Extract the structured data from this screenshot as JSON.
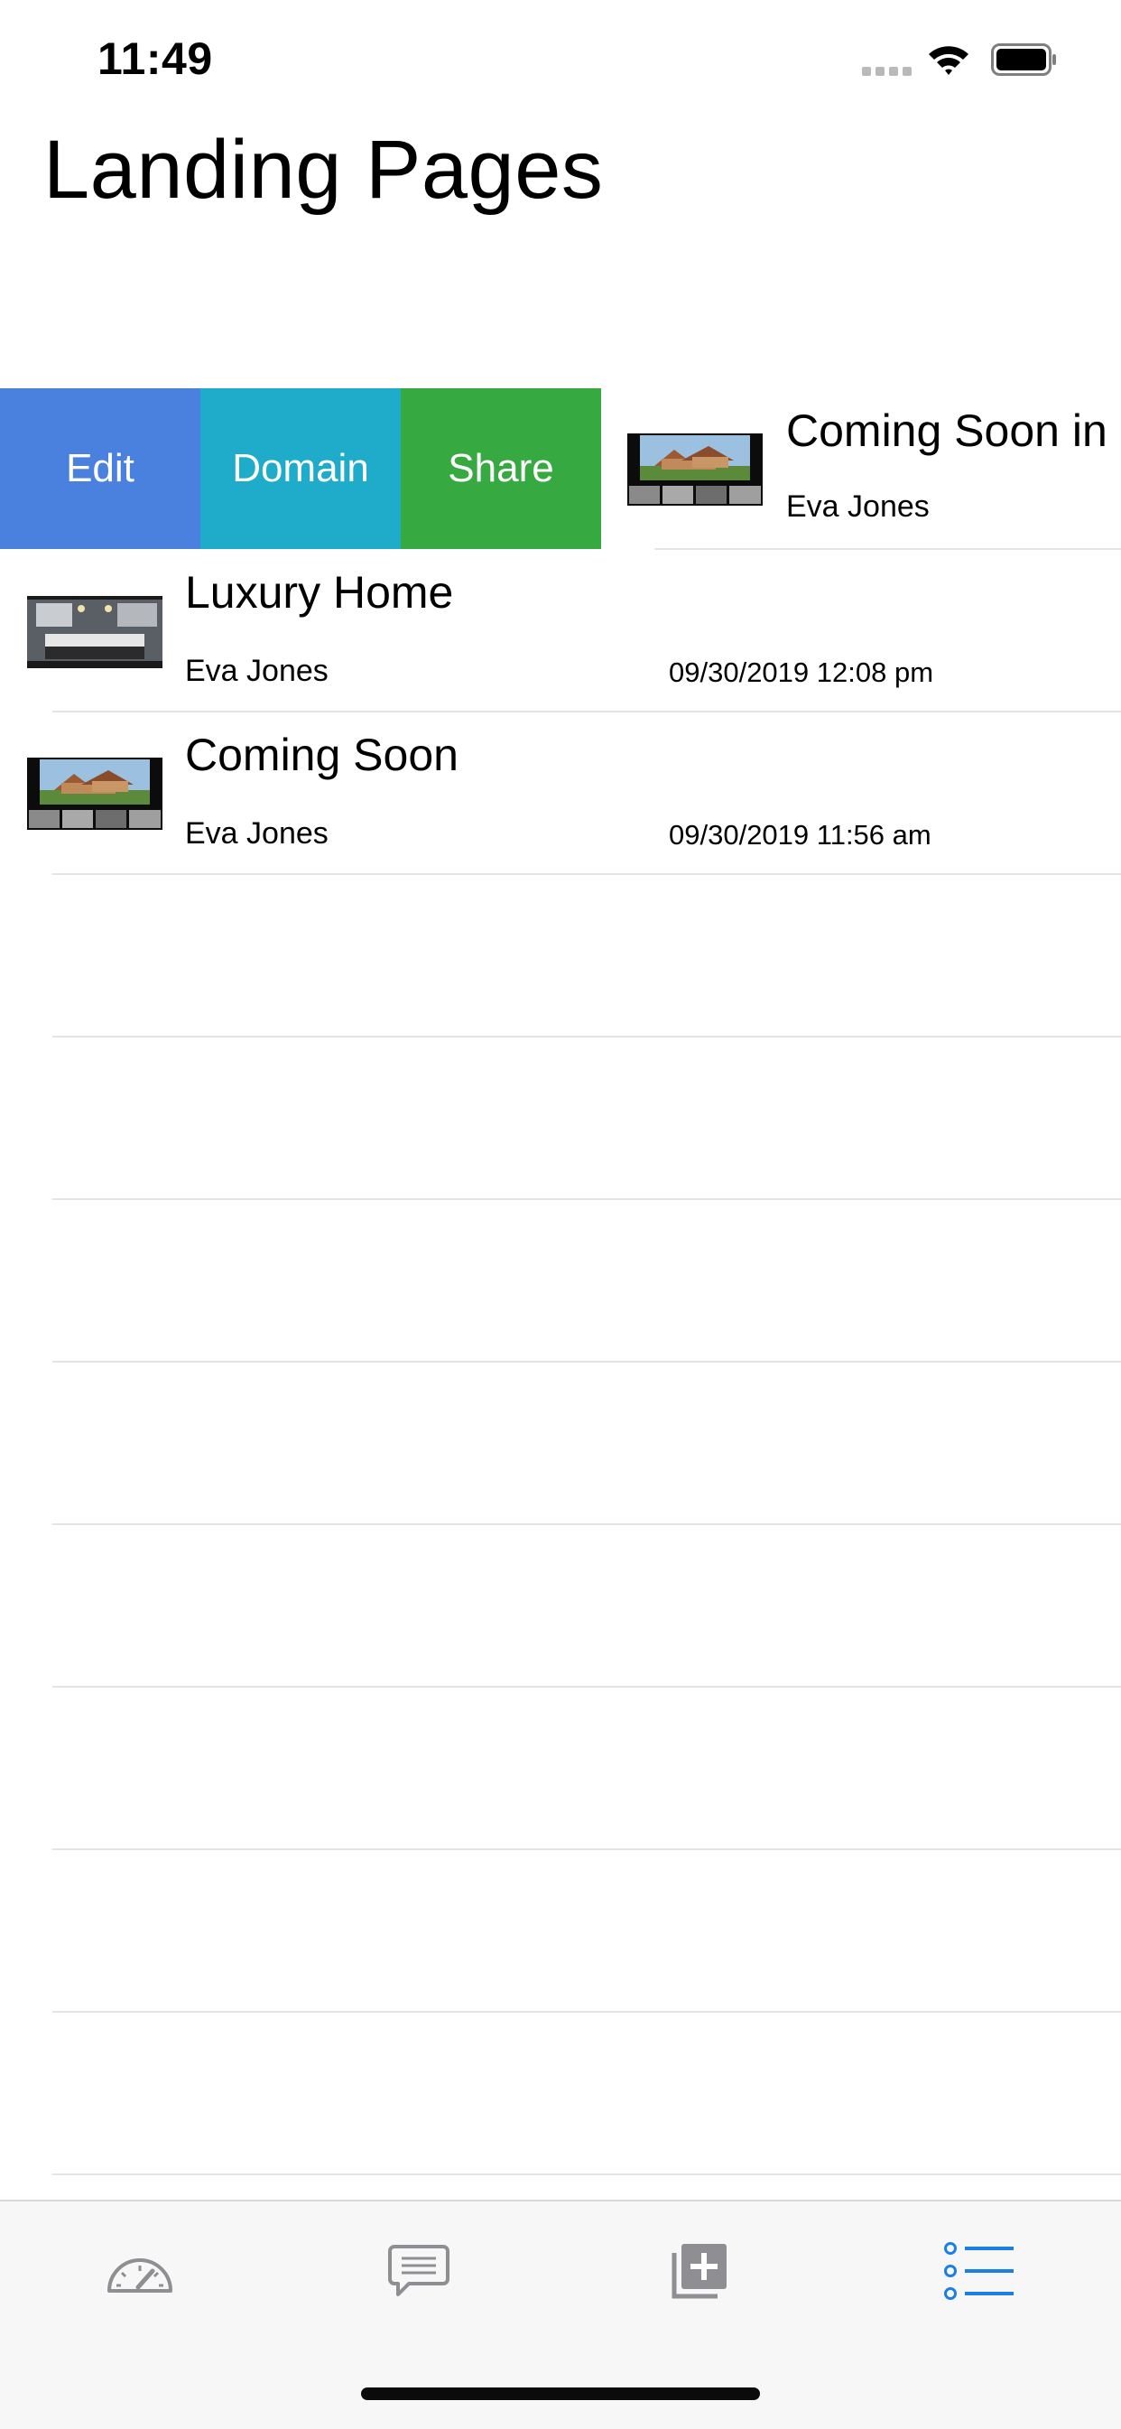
{
  "status_bar": {
    "time": "11:49"
  },
  "page": {
    "title": "Landing Pages"
  },
  "swipe_actions": [
    {
      "label": "Edit",
      "color": "#4a80de"
    },
    {
      "label": "Domain",
      "color": "#1fabca"
    },
    {
      "label": "Share",
      "color": "#36a940"
    }
  ],
  "pages": [
    {
      "title": "Coming Soon in",
      "author": "Eva Jones",
      "date": ""
    },
    {
      "title": "Luxury Home",
      "author": "Eva Jones",
      "date": "09/30/2019 12:08 pm"
    },
    {
      "title": "Coming Soon",
      "author": "Eva Jones",
      "date": "09/30/2019 11:56 am"
    }
  ],
  "tabs": [
    {
      "icon": "speedometer-icon",
      "active": false
    },
    {
      "icon": "message-bubble-icon",
      "active": false
    },
    {
      "icon": "add-photo-icon",
      "active": false
    },
    {
      "icon": "list-icon",
      "active": true
    }
  ],
  "colors": {
    "accent": "#1a7fe8",
    "tab_inactive": "#8e8e93",
    "separator": "#e4e4e4"
  }
}
